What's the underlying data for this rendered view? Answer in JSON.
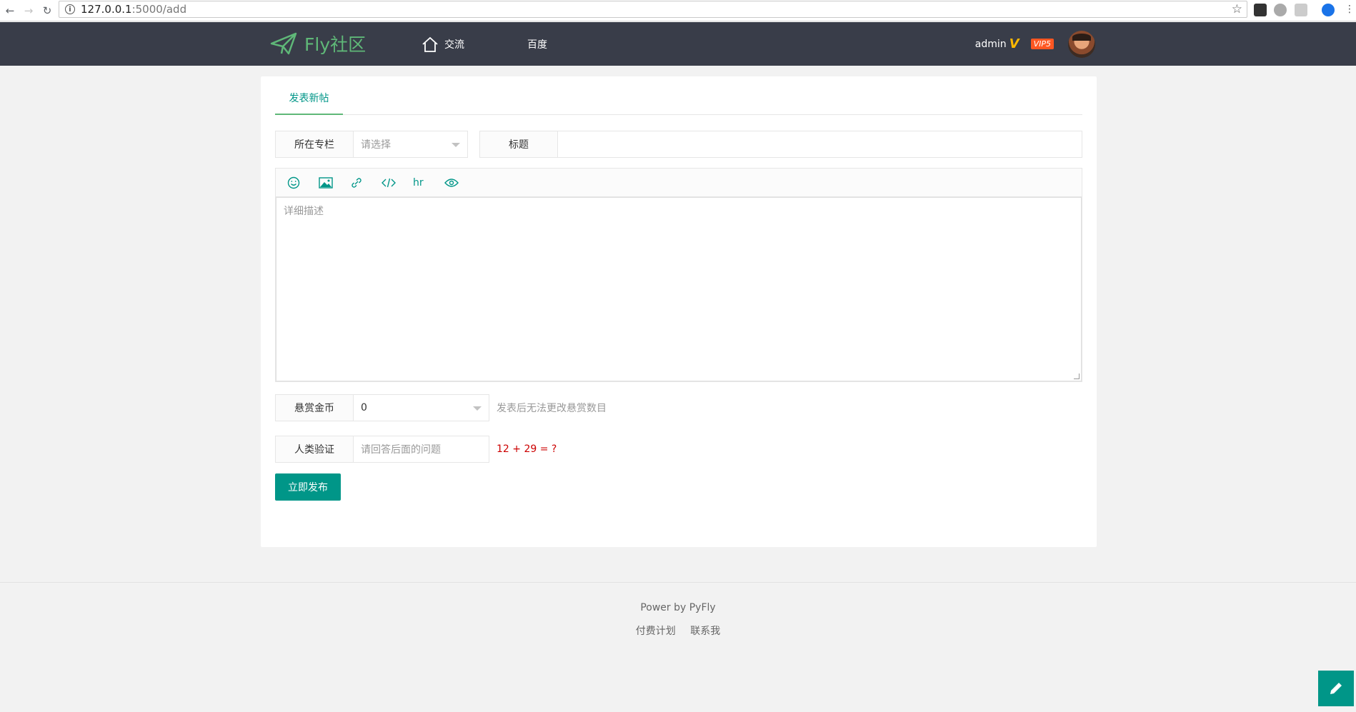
{
  "browser": {
    "url_host": "127.0.0.1",
    "url_path": ":5000/add"
  },
  "header": {
    "logo_text": "Fly社区",
    "nav": [
      {
        "label": "交流"
      },
      {
        "label": "百度"
      }
    ],
    "user": {
      "name": "admin",
      "verified_mark": "V",
      "vip_badge": "VIP5"
    }
  },
  "tabs": [
    {
      "label": "发表新帖"
    }
  ],
  "form": {
    "column": {
      "label": "所在专栏",
      "placeholder": "请选择"
    },
    "title": {
      "label": "标题",
      "value": ""
    },
    "editor": {
      "tools": [
        "emoji-icon",
        "image-icon",
        "link-icon",
        "code-icon",
        "hr",
        "preview-icon"
      ],
      "hr_label": "hr",
      "placeholder": "详细描述"
    },
    "reward": {
      "label": "悬赏金币",
      "value": "0",
      "hint": "发表后无法更改悬赏数目"
    },
    "captcha": {
      "label": "人类验证",
      "placeholder": "请回答后面的问题",
      "question": "12 + 29 = ?"
    },
    "submit_label": "立即发布"
  },
  "footer": {
    "power": "Power by PyFly",
    "links": [
      "付费计划",
      "联系我"
    ]
  },
  "colors": {
    "header_bg": "#393d49",
    "accent": "#009688",
    "logo_green": "#5fb878",
    "vip_orange": "#ff5722",
    "captcha_red": "#cc0000"
  }
}
